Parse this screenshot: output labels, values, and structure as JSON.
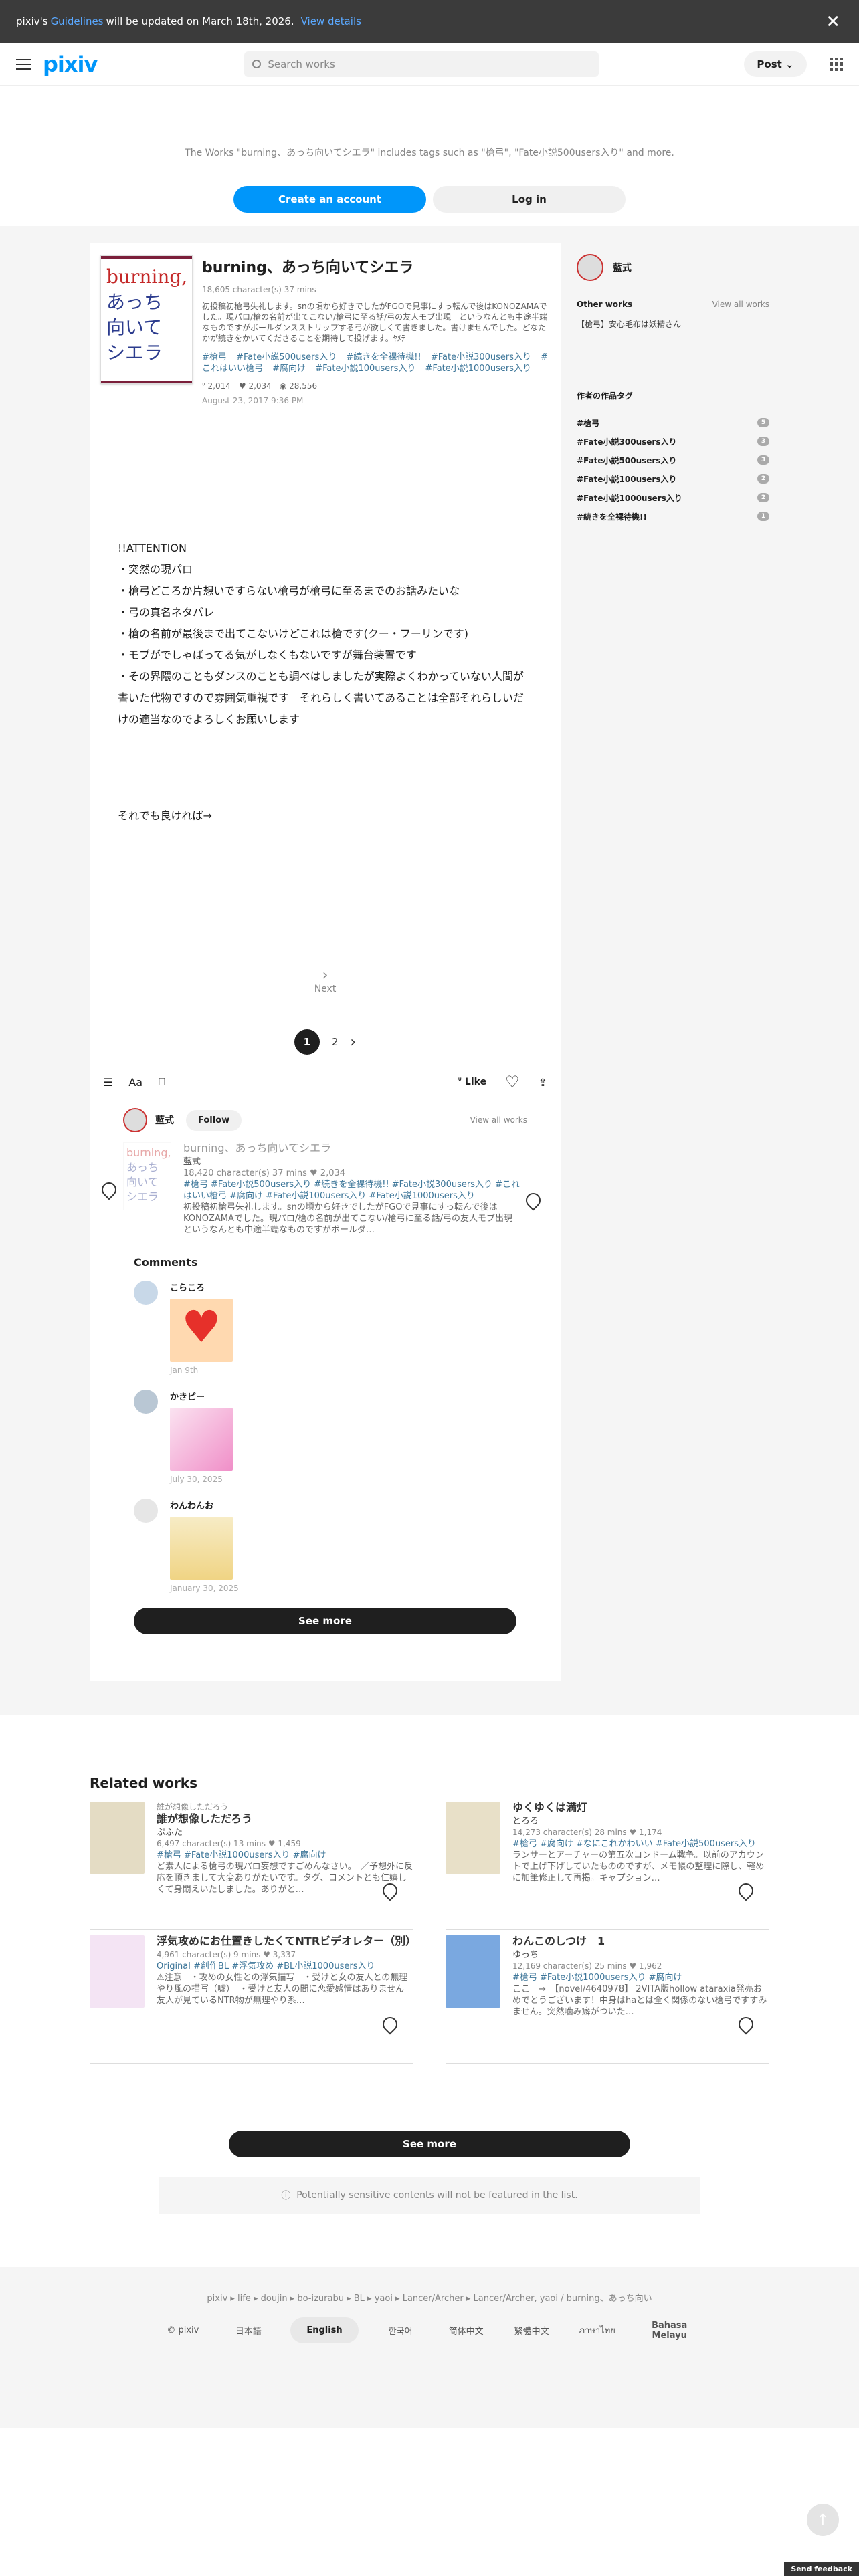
{
  "notice": {
    "pre": "pixiv's",
    "link": "Guidelines",
    "post": "will be updated on March 18th, 2026.",
    "view": "View details",
    "close": "✕"
  },
  "header": {
    "logo": "pixiv",
    "search_placeholder": "Search works",
    "post_label": "Post"
  },
  "promo": {
    "text": "The Works \"burning、あっち向いてシエラ\" includes tags such as \"槍弓\", \"Fate小説500users入り\" and more.",
    "create": "Create an account",
    "login": "Log in"
  },
  "work": {
    "cover_red": "burning,",
    "cover_blue": [
      "あっち",
      "向いて",
      "シエラ"
    ],
    "title": "burning、あっち向いてシエラ",
    "meta": "18,605 character(s)  37 mins",
    "caption": "初投稿初槍弓失礼します。snの頃から好きでしたがFGOで見事にすっ転んで後はKONOZAMAでした。現パロ/槍の名前が出てこない/槍弓に至る話/弓の友人モブ出現　というなんとも中途半端なものですがボールダンスストリップする弓が欲しくて書きました。書けませんでした。どなたかが続きをかいてくださることを期待して投げます。ﾔﾒﾃ",
    "tags": [
      "#槍弓",
      "#Fate小説500users入り",
      "#続きを全裸待機!!",
      "#Fate小説300users入り",
      "#これはいい槍弓",
      "#腐向け",
      "#Fate小説100users入り",
      "#Fate小説1000users入り"
    ],
    "likes": "2,014",
    "bookmarks": "2,034",
    "views": "28,556",
    "date": "August 23, 2017 9:36 PM"
  },
  "novel": {
    "lines": [
      "!!ATTENTION",
      "・突然の現パロ",
      "・槍弓どころか片想いですらない槍弓が槍弓に至るまでのお話みたいな",
      "・弓の真名ネタバレ",
      "・槍の名前が最後まで出てこないけどこれは槍です(クー・フーリンです)",
      "・モブがでしゃばってる気がしなくもないですが舞台装置です",
      "・その界隈のこともダンスのことも調べはしましたが実際よくわかっていない人間が",
      "書いた代物ですので雰囲気重視です　それらしく書いてあることは全部それらしいだ",
      "けの適当なのでよろしくお願いします"
    ],
    "last": "それでも良ければ→",
    "next": "Next",
    "pages": [
      "1",
      "2"
    ]
  },
  "toolbar": {
    "like": "Like"
  },
  "author": {
    "name": "藍式",
    "follow": "Follow",
    "view_all": "View all works"
  },
  "mini_work": {
    "title": "burning、あっち向いてシエラ",
    "author": "藍式",
    "meta": "18,420 character(s)  37 mins  ♥ 2,034",
    "tags": "#槍弓 #Fate小説500users入り #続きを全裸待機!! #Fate小説300users入り #これはいい槍弓 #腐向け #Fate小説100users入り #Fate小説1000users入り",
    "caption": "初投稿初槍弓失礼します。snの頃から好きでしたがFGOで見事にすっ転んで後はKONOZAMAでした。現パロ/槍の名前が出てこない/槍弓に至る話/弓の友人モブ出現　というなんとも中途半端なものですがボールダ…"
  },
  "comments": {
    "heading": "Comments",
    "items": [
      {
        "name": "こらころ",
        "date": "Jan 9th",
        "color": "#ffd9b0"
      },
      {
        "name": "かきピー",
        "date": "July 30, 2025",
        "color": "#f7c8e4"
      },
      {
        "name": "わんわんお",
        "date": "January 30, 2025",
        "color": "#f7ecc6"
      }
    ],
    "see_more": "See more"
  },
  "side": {
    "author": "藍式",
    "other_works": "Other works",
    "view_all": "View all works",
    "other_item": "【槍弓】安心毛布は妖精さん",
    "tags_heading": "作者の作品タグ",
    "tags": [
      {
        "name": "#槍弓",
        "count": "5"
      },
      {
        "name": "#Fate小説300users入り",
        "count": "3"
      },
      {
        "name": "#Fate小説500users入り",
        "count": "3"
      },
      {
        "name": "#Fate小説100users入り",
        "count": "2"
      },
      {
        "name": "#Fate小説1000users入り",
        "count": "2"
      },
      {
        "name": "#続きを全裸待機!!",
        "count": "1"
      }
    ]
  },
  "related": {
    "heading": "Related works",
    "items": [
      {
        "sub": "誰が想像しただろう",
        "title": "誰が想像しただろう",
        "author": "ぷふた",
        "meta": "6,497 character(s)  13 mins  ♥ 1,459",
        "tags": "#槍弓 #Fate小説1000users入り #腐向け",
        "caption": "ど素人による槍弓の現パロ妄想ですごめんなさい。　／予想外に反応を頂きまして大変ありがたいです。タグ、コメントとも仁嬉しくて身悶えいたしました。ありがと…",
        "color": "#e4dcc4"
      },
      {
        "sub": "",
        "title": "ゆくゆくは満灯",
        "author": "とろろ",
        "meta": "14,273 character(s)  28 mins  ♥ 1,174",
        "tags": "#槍弓 #腐向け #なにこれかわいい #Fate小説500users入り",
        "caption": "ランサーとアーチャーの第五次コンドーム戦争。以前のアカウントで上げ下げしていたもののですが、メモ帳の整理に際し、軽めに加筆修正して再掲。キャプション…",
        "color": "#e8e0c8"
      },
      {
        "sub": "",
        "title": "浮気攻めにお仕置きしたくてNTRビデオレター（別）",
        "author": "",
        "meta": "4,961 character(s)  9 mins  ♥ 3,337",
        "tags": "Original #創作BL #浮気攻め #BL小説1000users入り",
        "caption": "⚠注意　・攻めの女性との浮気描写　・受けと女の友人との無理やり風の描写（嘘）　・受けと友人の間に恋愛感情はありません　友人が見ているNTR物が無理やり系…",
        "color": "#f4e4f4"
      },
      {
        "sub": "",
        "title": "わんこのしつけ　1",
        "author": "ゆっち",
        "meta": "12,169 character(s)  25 mins  ♥ 1,962",
        "tags": "#槍弓 #Fate小説1000users入り #腐向け",
        "caption": "ここ　→　【novel/4640978】 2VITA版hollow ataraxia発売おめでとうございます！中身はhaとは全く関係のない槍弓ですすみません。突然噛み癖がついた…",
        "color": "#7aa8e0"
      }
    ],
    "see_more": "See more",
    "sensitive": "Potentially sensitive contents will not be featured in the list."
  },
  "footer": {
    "crumbs": "pixiv ▸ life ▸ doujin ▸ bo-izurabu ▸ BL ▸ yaoi ▸ Lancer/Archer ▸ Lancer/Archer, yaoi / burning、あっち向い",
    "langs": [
      "© pixiv",
      "日本語",
      "English",
      "한국어",
      "简体中文",
      "繁體中文",
      "ภาษาไทย",
      "Bahasa Melayu"
    ],
    "feedback": "Send feedback"
  }
}
